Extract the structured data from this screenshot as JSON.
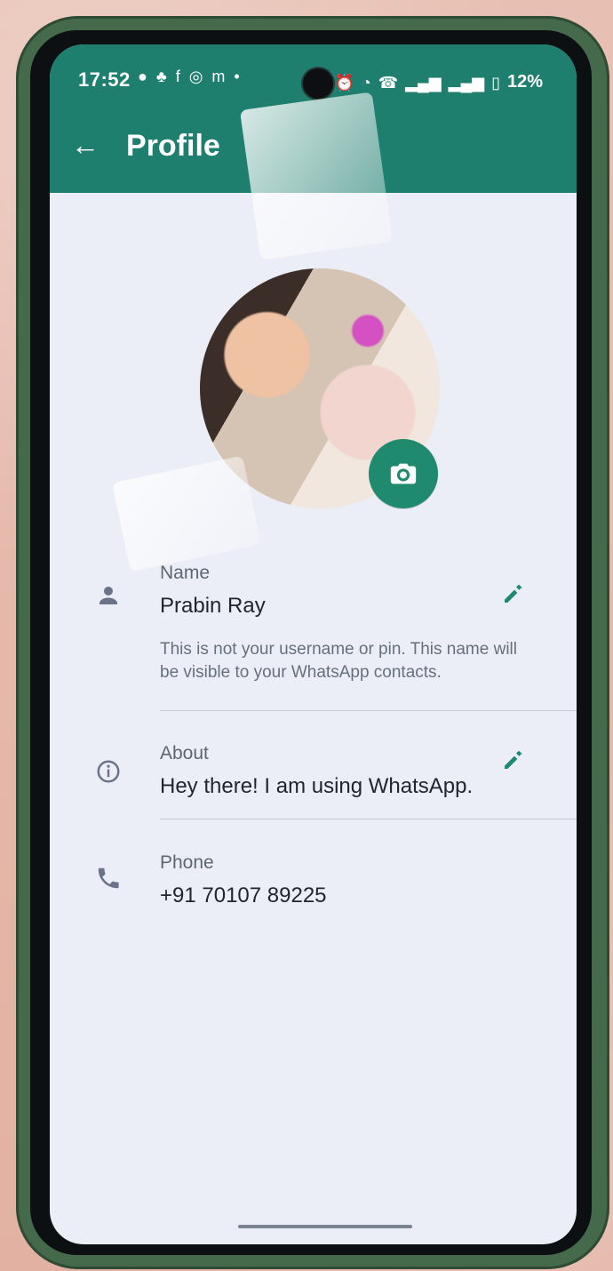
{
  "statusbar": {
    "time": "17:52",
    "left_icons": [
      "message-icon",
      "snapchat-icon",
      "facebook-icon",
      "instagram-icon",
      "m-icon",
      "dot-icon"
    ],
    "right_icons": [
      "alarm-icon",
      "wifi-icon",
      "call-icon",
      "signal-icon",
      "signal-icon",
      "battery-icon"
    ],
    "battery": "12%",
    "accent": "#1f7f6f"
  },
  "toolbar": {
    "title": "Profile"
  },
  "profile": {
    "name_label": "Name",
    "name_value": "Prabin Ray",
    "name_help": "This is not your username or pin. This name will be visible to your WhatsApp contacts.",
    "about_label": "About",
    "about_value": "Hey there! I am using WhatsApp.",
    "phone_label": "Phone",
    "phone_value": "+91 70107 89225"
  },
  "colors": {
    "edit_icon": "#1c8a72",
    "divider": "#c7ccd6",
    "text_primary": "#20262c",
    "text_secondary": "#5d6770"
  }
}
